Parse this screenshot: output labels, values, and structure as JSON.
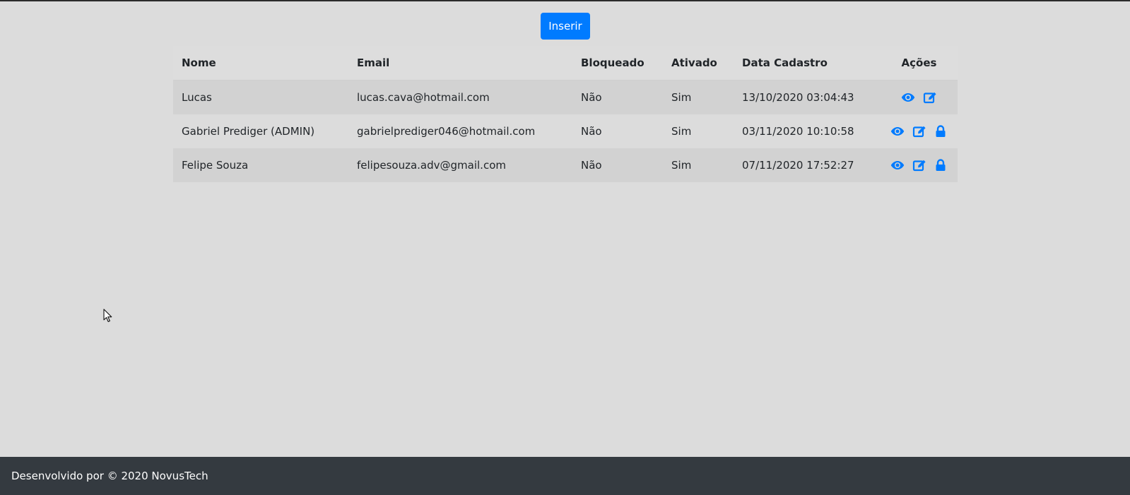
{
  "toolbar": {
    "insert_label": "Inserir"
  },
  "table": {
    "headers": {
      "name": "Nome",
      "email": "Email",
      "blocked": "Bloqueado",
      "active": "Ativado",
      "created": "Data Cadastro",
      "actions": "Ações"
    },
    "rows": [
      {
        "name": "Lucas",
        "email": "lucas.cava@hotmail.com",
        "blocked": "Não",
        "active": "Sim",
        "created": "13/10/2020 03:04:43",
        "actions": [
          "eye-icon",
          "edit-icon"
        ]
      },
      {
        "name": "Gabriel Prediger (ADMIN)",
        "email": "gabrielprediger046@hotmail.com",
        "blocked": "Não",
        "active": "Sim",
        "created": "03/11/2020 10:10:58",
        "actions": [
          "eye-icon",
          "edit-icon",
          "lock-icon"
        ]
      },
      {
        "name": "Felipe Souza",
        "email": "felipesouza.adv@gmail.com",
        "blocked": "Não",
        "active": "Sim",
        "created": "07/11/2020 17:52:27",
        "actions": [
          "eye-icon",
          "edit-icon",
          "lock-icon"
        ]
      }
    ]
  },
  "footer": {
    "text": "Desenvolvido por © 2020 NovusTech"
  },
  "colors": {
    "accent": "#007bff",
    "footer_bg": "#343a40",
    "page_bg": "#dcdcdc",
    "striped_row": "#d2d2d2"
  }
}
